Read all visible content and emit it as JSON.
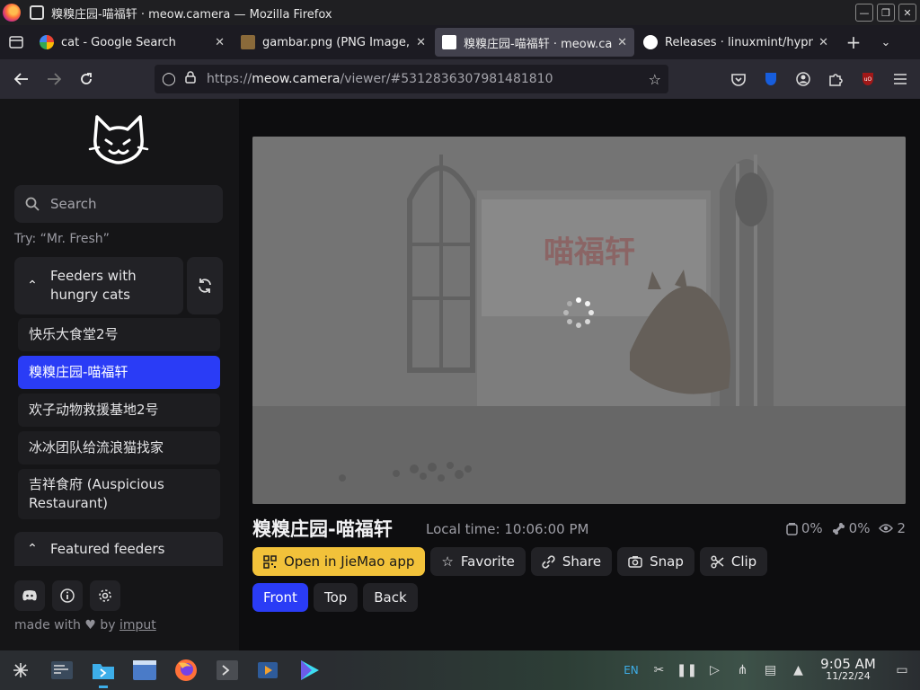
{
  "window": {
    "title": "糗糗庄园-喵福轩 · meow.camera — Mozilla Firefox"
  },
  "tabs": [
    {
      "label": "cat - Google Search",
      "icon": "google-icon"
    },
    {
      "label": "gambar.png (PNG Image, 1",
      "icon": "image-icon"
    },
    {
      "label": "糗糗庄园-喵福轩 · meow.ca",
      "icon": "meow-camera-icon",
      "active": true
    },
    {
      "label": "Releases · linuxmint/hypn",
      "icon": "github-icon"
    }
  ],
  "urlbar": {
    "scheme": "https://",
    "host": "meow.camera",
    "path": "/viewer/#5312836307981481810"
  },
  "sidebar": {
    "search_placeholder": "Search",
    "hint": "Try: “Mr. Fresh”",
    "group_label": "Feeders with hungry cats",
    "feeders": [
      {
        "label": "快乐大食堂2号"
      },
      {
        "label": "糗糗庄园-喵福轩",
        "active": true
      },
      {
        "label": "欢子动物救援基地2号"
      },
      {
        "label": "冰冰团队给流浪猫找家"
      },
      {
        "label": "吉祥食府 (Auspicious Restaurant)"
      }
    ],
    "featured_label": "Featured feeders",
    "credit_prefix": "made with",
    "credit_by": "by",
    "credit_link": "imput"
  },
  "viewer": {
    "title": "糗糗庄园-喵福轩",
    "local_time": "Local time: 10:06:00 PM",
    "stats": {
      "food": "0%",
      "treat": "0%",
      "viewers": "2"
    },
    "actions": {
      "open_app": "Open in JieMao app",
      "favorite": "Favorite",
      "share": "Share",
      "snap": "Snap",
      "clip": "Clip"
    },
    "camera_tabs": [
      {
        "label": "Front",
        "active": true
      },
      {
        "label": "Top"
      },
      {
        "label": "Back"
      }
    ],
    "video_sign": "喵福轩"
  },
  "taskbar": {
    "lang": "EN",
    "time": "9:05 AM",
    "date": "11/22/24"
  },
  "colors": {
    "accent_blue": "#2a3cf6",
    "primary_yellow": "#f2c23a"
  }
}
